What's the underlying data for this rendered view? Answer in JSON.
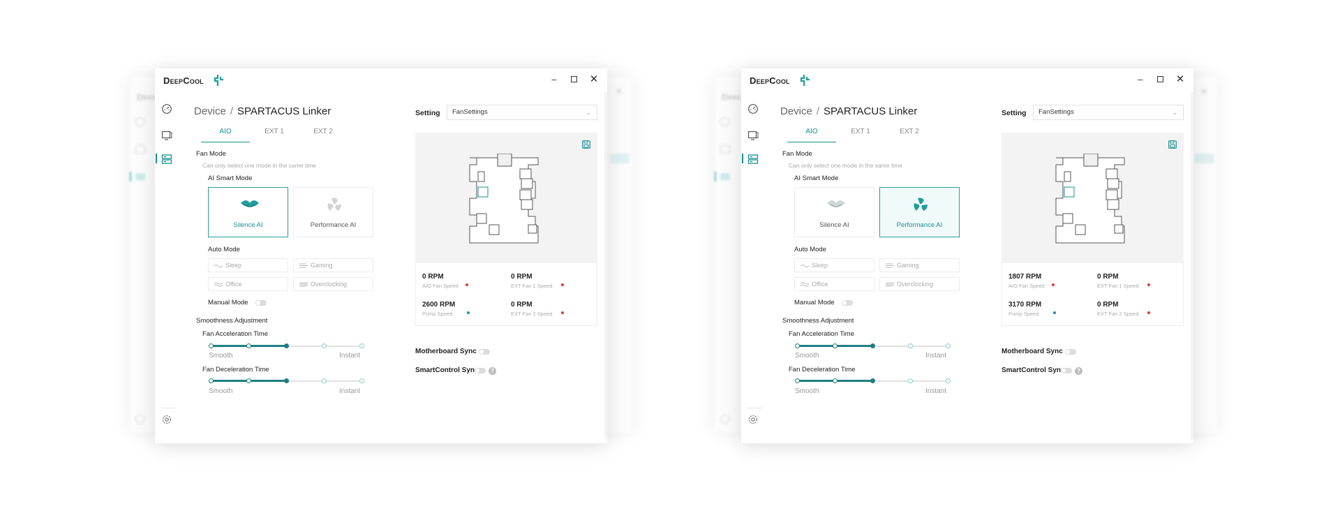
{
  "windows": [
    {
      "app_name": "DeepCool",
      "breadcrumb_root": "Device",
      "breadcrumb_sep": "/",
      "device": "SPARTACUS Linker",
      "tabs": [
        "AIO",
        "EXT 1",
        "EXT 2"
      ],
      "active_tab": "AIO",
      "fan_mode_label": "Fan Mode",
      "fan_mode_hint": "Can only select one mode in the same time",
      "ai_smart_label": "AI Smart Mode",
      "ai_cards": [
        {
          "label": "Silence AI",
          "selected": true
        },
        {
          "label": "Performance AI",
          "selected": false
        }
      ],
      "auto_mode_label": "Auto Mode",
      "auto_modes": [
        "Sleep",
        "Gaming",
        "Office",
        "Overclocking"
      ],
      "manual_mode_label": "Manual Mode",
      "smoothness_label": "Smoothness Adjustment",
      "accel_label": "Fan Acceleration Time",
      "decel_label": "Fan Deceleration Time",
      "slider_min_label": "Smooth",
      "slider_max_label": "Instant",
      "accel_level": 2,
      "decel_level": 2,
      "setting_label": "Setting",
      "setting_value": "FanSettings",
      "stats": [
        {
          "rpm": "0 RPM",
          "label": "AIO Fan Speed",
          "dot": "#e53935"
        },
        {
          "rpm": "0 RPM",
          "label": "EXT Fan 1 Speed",
          "dot": "#e53935"
        },
        {
          "rpm": "2600 RPM",
          "label": "Pump Speed",
          "dot": "#1d8fb0"
        },
        {
          "rpm": "0 RPM",
          "label": "EXT Fan 2 Speed",
          "dot": "#e53935"
        }
      ],
      "motherboard_sync": "Motherboard Sync",
      "smartcontrol_sync": "SmartControl Sync",
      "help_glyph": "?"
    },
    {
      "app_name": "DeepCool",
      "breadcrumb_root": "Device",
      "breadcrumb_sep": "/",
      "device": "SPARTACUS Linker",
      "tabs": [
        "AIO",
        "EXT 1",
        "EXT 2"
      ],
      "active_tab": "AIO",
      "fan_mode_label": "Fan Mode",
      "fan_mode_hint": "Can only select one mode in the same time",
      "ai_smart_label": "AI Smart Mode",
      "ai_cards": [
        {
          "label": "Silence AI",
          "selected": false
        },
        {
          "label": "Performance AI",
          "selected": true
        }
      ],
      "auto_mode_label": "Auto Mode",
      "auto_modes": [
        "Sleep",
        "Gaming",
        "Office",
        "Overclocking"
      ],
      "manual_mode_label": "Manual Mode",
      "smoothness_label": "Smoothness Adjustment",
      "accel_label": "Fan Acceleration Time",
      "decel_label": "Fan Deceleration Time",
      "slider_min_label": "Smooth",
      "slider_max_label": "Instant",
      "accel_level": 2,
      "decel_level": 2,
      "setting_label": "Setting",
      "setting_value": "FanSettings",
      "stats": [
        {
          "rpm": "1807 RPM",
          "label": "AIO Fan Speed",
          "dot": "#e53935"
        },
        {
          "rpm": "0 RPM",
          "label": "EXT Fan 1 Speed",
          "dot": "#e53935"
        },
        {
          "rpm": "3170 RPM",
          "label": "Pump Speed",
          "dot": "#1d8fb0"
        },
        {
          "rpm": "0 RPM",
          "label": "EXT Fan 2 Speed",
          "dot": "#e53935"
        }
      ],
      "motherboard_sync": "Motherboard Sync",
      "smartcontrol_sync": "SmartControl Sync",
      "help_glyph": "?"
    }
  ],
  "colors": {
    "accent": "#188f8f",
    "accent_dark": "#1d7f82",
    "dot_red": "#e53935",
    "dot_blue": "#1d8fb0"
  },
  "icons": [
    "dashboard-icon",
    "display-icon",
    "device-list-icon",
    "settings-gear-icon",
    "save-icon",
    "silence-ai-icon",
    "performance-ai-icon",
    "minimize-icon",
    "maximize-icon",
    "close-icon"
  ]
}
